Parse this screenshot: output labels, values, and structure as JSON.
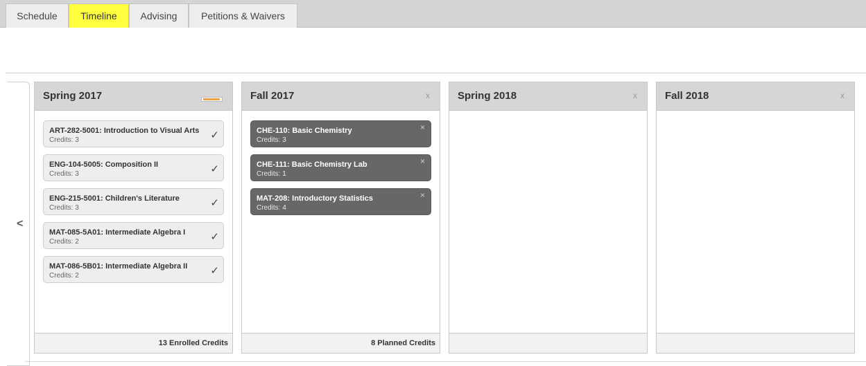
{
  "tabs": [
    {
      "label": "Schedule"
    },
    {
      "label": "Timeline"
    },
    {
      "label": "Advising"
    },
    {
      "label": "Petitions & Waivers"
    }
  ],
  "active_tab": "Timeline",
  "nav": {
    "prev_glyph": "<"
  },
  "terms": [
    {
      "title": "Spring 2017",
      "progress": 0.9,
      "footer": "13 Enrolled Credits",
      "courses": [
        {
          "name": "ART-282-5001: Introduction to Visual Arts",
          "credits": "Credits: 3",
          "status_icon": "✓"
        },
        {
          "name": "ENG-104-5005: Composition II",
          "credits": "Credits: 3",
          "status_icon": "✓"
        },
        {
          "name": "ENG-215-5001: Children's Literature",
          "credits": "Credits: 3",
          "status_icon": "✓"
        },
        {
          "name": "MAT-085-5A01: Intermediate Algebra I",
          "credits": "Credits: 2",
          "status_icon": "✓"
        },
        {
          "name": "MAT-086-5B01: Intermediate Algebra II",
          "credits": "Credits: 2",
          "status_icon": "✓"
        }
      ]
    },
    {
      "title": "Fall 2017",
      "close": "x",
      "footer": "8 Planned Credits",
      "courses": [
        {
          "name": "CHE-110: Basic Chemistry",
          "credits": "Credits: 3",
          "remove": "×"
        },
        {
          "name": "CHE-111: Basic Chemistry Lab",
          "credits": "Credits: 1",
          "remove": "×"
        },
        {
          "name": "MAT-208: Introductory Statistics",
          "credits": "Credits: 4",
          "remove": "×"
        }
      ]
    },
    {
      "title": "Spring 2018",
      "close": "x",
      "footer": ""
    },
    {
      "title": "Fall 2018",
      "close": "x",
      "footer": ""
    }
  ],
  "colors": {
    "active_tab": "#ffff40",
    "planned_course": "#676767",
    "enrolled_course": "#eeeeee",
    "progress_fill": "#f0a040"
  }
}
